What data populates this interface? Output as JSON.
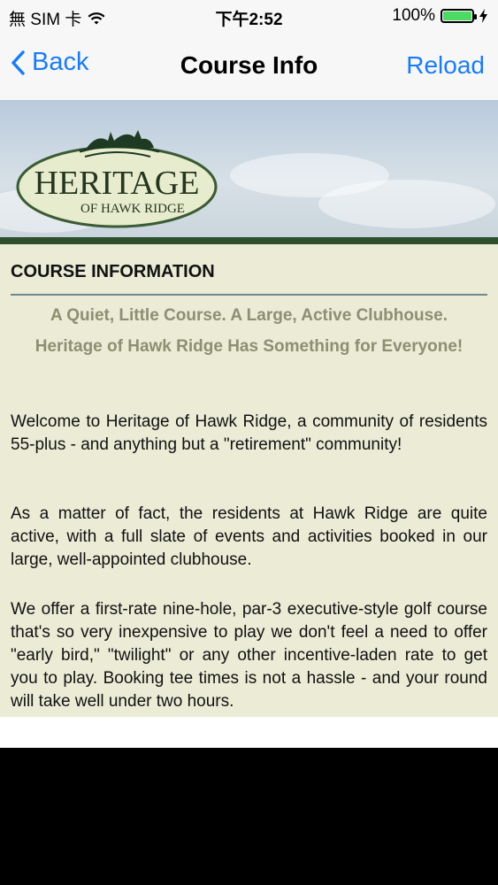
{
  "status_bar": {
    "carrier": "無 SIM 卡",
    "time": "下午2:52",
    "battery": "100%",
    "battery_level": 1.0
  },
  "nav": {
    "back_label": "Back",
    "title": "Course Info",
    "reload_label": "Reload"
  },
  "logo": {
    "line1": "HERITAGE",
    "line2": "OF HAWK RIDGE"
  },
  "content": {
    "heading": "COURSE INFORMATION",
    "tagline1": "A Quiet, Little Course. A Large, Active Clubhouse.",
    "tagline2": "Heritage of Hawk Ridge Has Something for Everyone!",
    "paragraphs": [
      "Welcome to Heritage of Hawk Ridge, a community of residents 55-plus - and anything but a \"retirement\" community!",
      "As a matter of fact, the residents at Hawk Ridge are quite active, with a full slate of events and activities booked in our large, well-appointed clubhouse.",
      "We offer a first-rate nine-hole, par-3 executive-style golf course that's so very inexpensive to play we don't feel a need to offer \"early bird,\" \"twilight\" or any other incentive-laden rate to get you to play. Booking tee times is not a hassle - and your round will take well under two hours."
    ]
  },
  "colors": {
    "ios_blue": "#1a7cf5",
    "content_bg": "#ebebd6",
    "tagline": "#8e8e72",
    "stripe": "#2e4f2b"
  }
}
